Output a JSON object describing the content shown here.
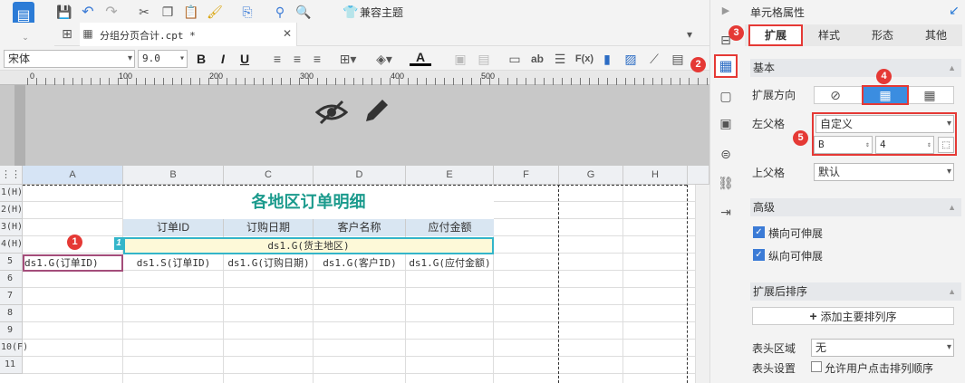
{
  "tab": {
    "file_name": "分组分页合计.cpt *",
    "compat_theme": "兼容主题"
  },
  "format": {
    "font_name": "宋体",
    "font_size": "9.0",
    "bold": "B",
    "italic": "I",
    "underline": "U",
    "ab": "ab",
    "fx": "F(x)"
  },
  "ruler": {
    "ticks": [
      "0",
      "100",
      "200",
      "300",
      "400",
      "500"
    ]
  },
  "columns": [
    "A",
    "B",
    "C",
    "D",
    "E",
    "F",
    "G",
    "H"
  ],
  "rows": [
    "1(H)",
    "2(H)",
    "3(H)",
    "4(H)",
    "5",
    "6",
    "7",
    "8",
    "9",
    "10(F)",
    "11"
  ],
  "report": {
    "title": "各地区订单明细",
    "headers": [
      "订单ID",
      "订购日期",
      "客户名称",
      "应付金额"
    ],
    "group_cell": "ds1.G(货主地区)",
    "row5": [
      "ds1.G(订单ID)",
      "ds1.S(订单ID)",
      "ds1.G(订购日期)",
      "ds1.G(客户ID)",
      "ds1.G(应付金额)"
    ]
  },
  "panel": {
    "title": "单元格属性",
    "tabs": [
      "扩展",
      "样式",
      "形态",
      "其他"
    ],
    "basic": "基本",
    "expand_dir": "扩展方向",
    "left_parent": "左父格",
    "left_parent_value": "自定义",
    "left_col": "B",
    "left_row": "4",
    "top_parent": "上父格",
    "top_parent_value": "默认",
    "advanced": "高级",
    "horizontal": "横向可伸展",
    "vertical": "纵向可伸展",
    "sort_section": "扩展后排序",
    "add_sort": "添加主要排列序",
    "header_area": "表头区域",
    "header_area_value": "无",
    "header_setting": "表头设置",
    "allow_sort": "允许用户点击排列顺序"
  },
  "badges": [
    "1",
    "2",
    "3",
    "4",
    "5"
  ],
  "icons": [
    "save-icon",
    "undo-icon",
    "redo-icon",
    "cut-icon",
    "copy-icon",
    "paste-icon",
    "format-painter-icon",
    "preview-icon",
    "debug-icon",
    "search-icon",
    "theme-icon",
    "hide-icon",
    "edit-icon"
  ]
}
